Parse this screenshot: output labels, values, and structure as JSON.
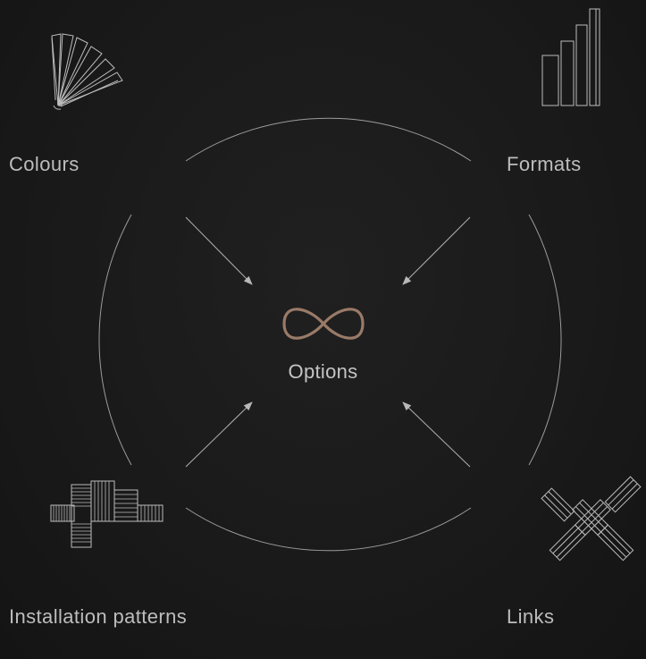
{
  "center": {
    "label": "Options",
    "icon": "infinity-icon",
    "accent_color": "#9a7a68"
  },
  "nodes": [
    {
      "id": "colours",
      "label": "Colours",
      "icon": "colour-fan-icon"
    },
    {
      "id": "formats",
      "label": "Formats",
      "icon": "bar-formats-icon"
    },
    {
      "id": "installation",
      "label": "Installation patterns",
      "icon": "pattern-cross-icon"
    },
    {
      "id": "links",
      "label": "Links",
      "icon": "herringbone-icon"
    }
  ],
  "colors": {
    "background": "#191919",
    "line": "#a8a8a8",
    "text": "#bdbdbd"
  }
}
